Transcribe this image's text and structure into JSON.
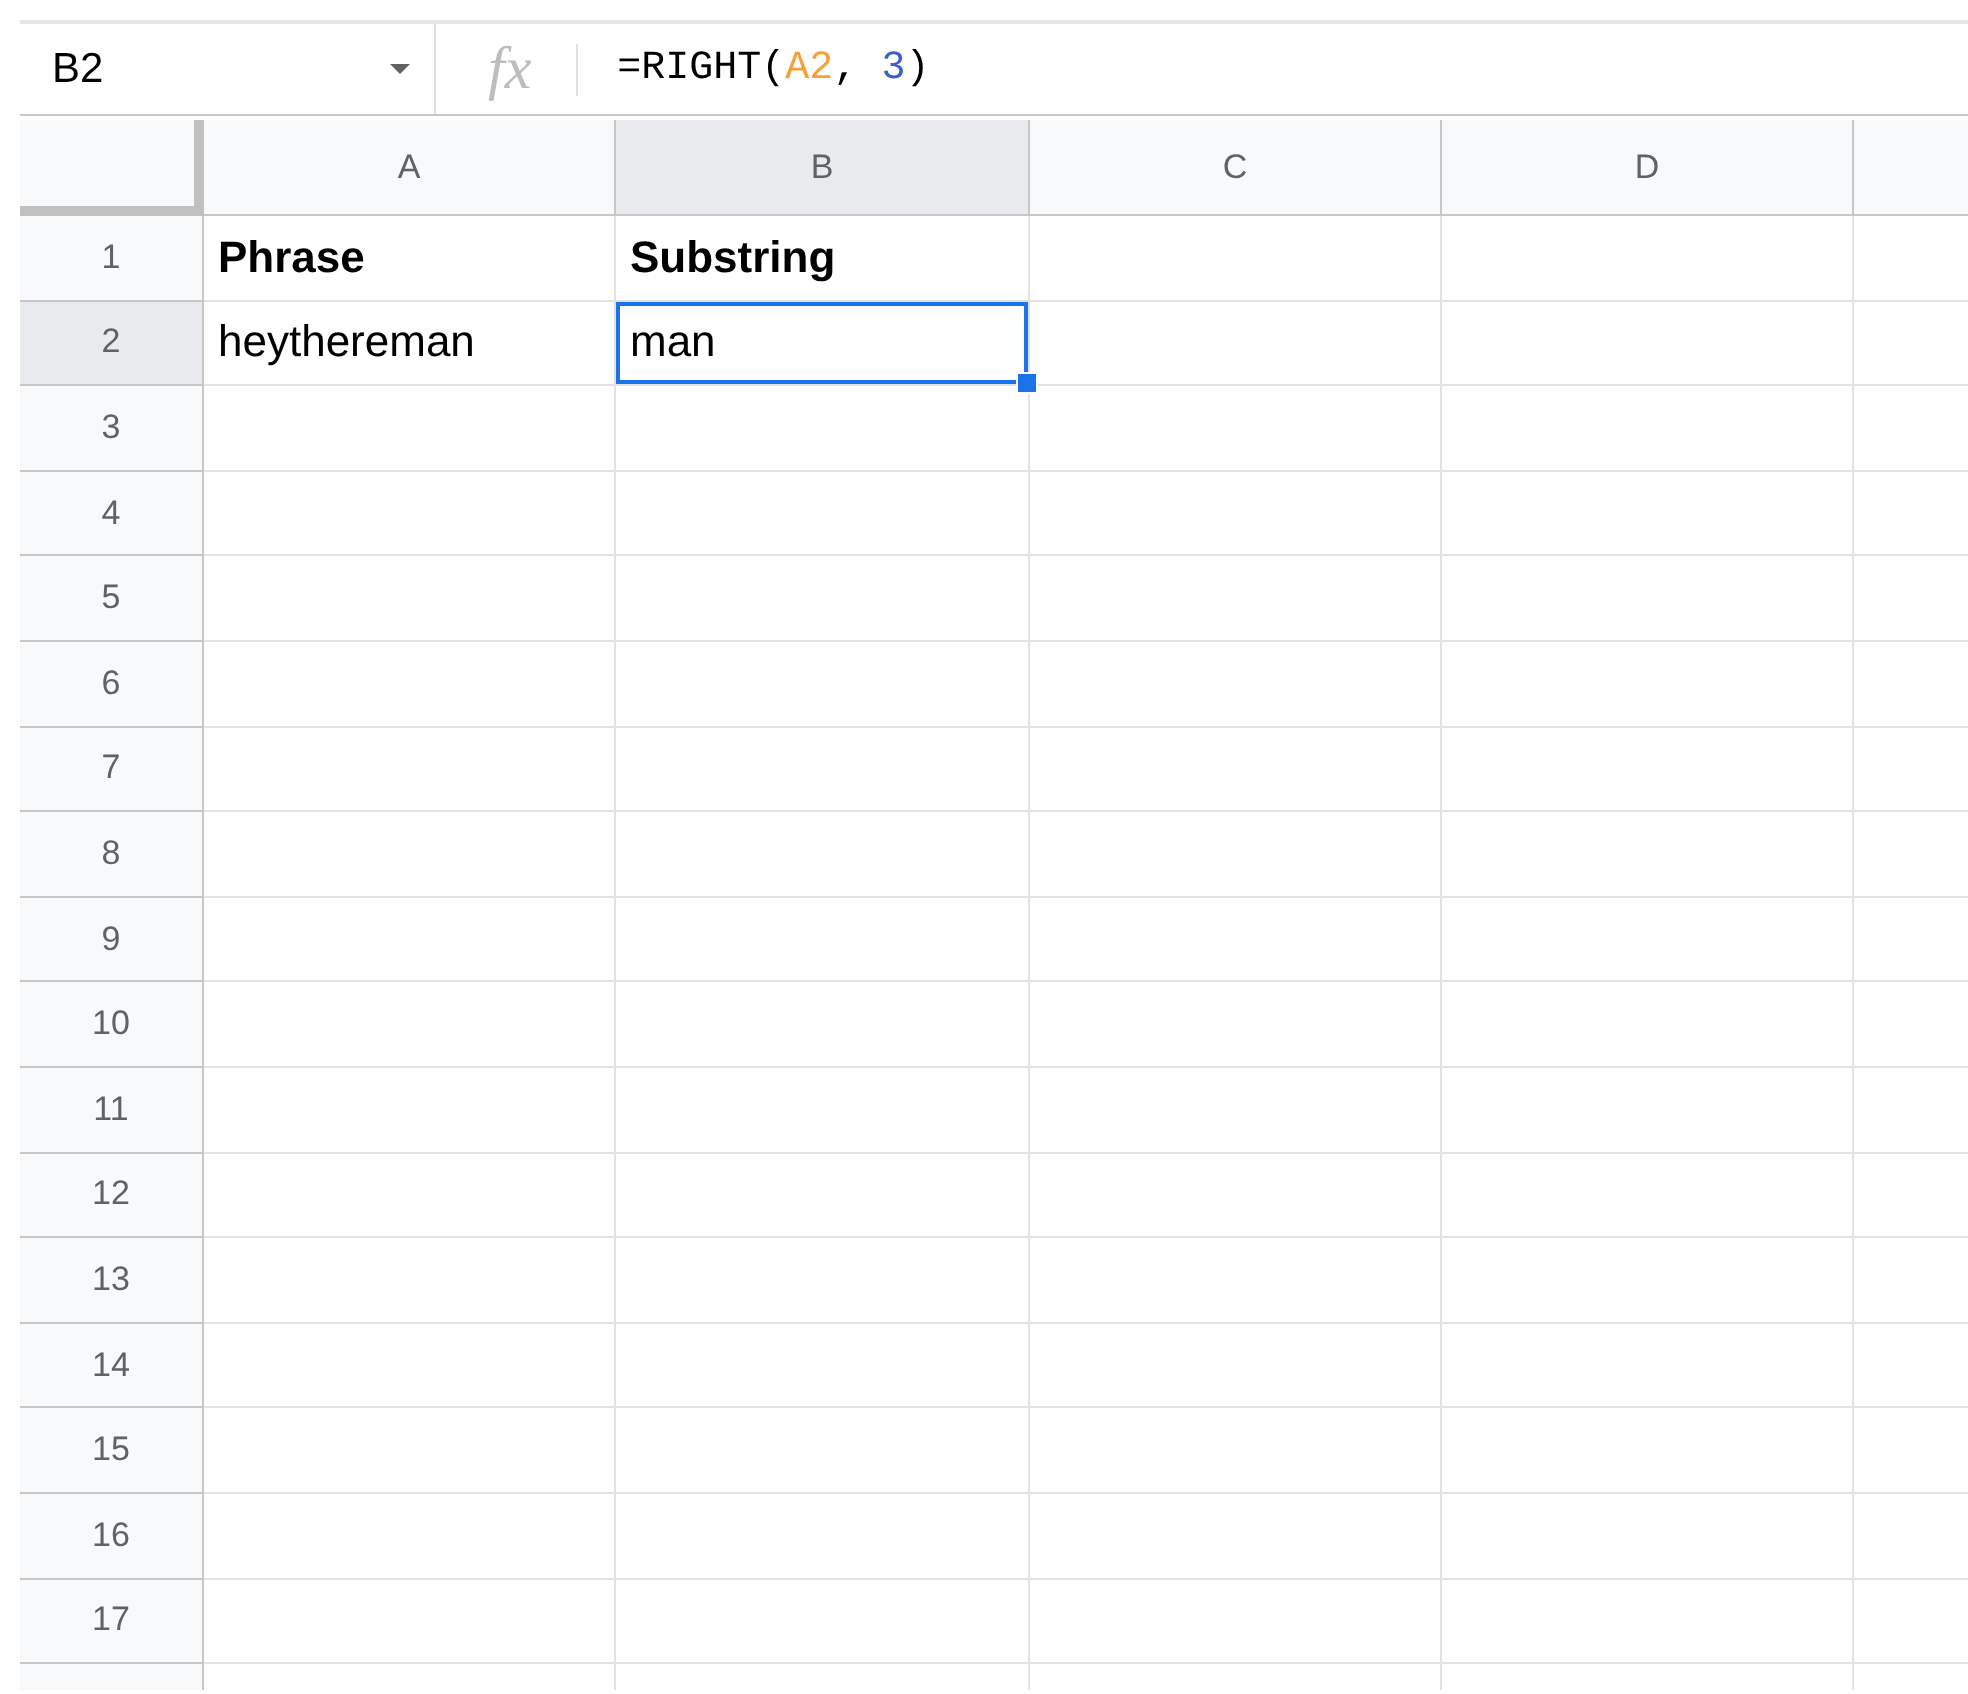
{
  "formula_bar": {
    "name_box": "B2",
    "fx_label": "fx",
    "formula": [
      {
        "text": "=RIGHT(",
        "kind": "plain"
      },
      {
        "text": "A2",
        "kind": "reference"
      },
      {
        "text": ", ",
        "kind": "plain"
      },
      {
        "text": "3",
        "kind": "number"
      },
      {
        "text": ")",
        "kind": "plain"
      }
    ]
  },
  "columns": [
    {
      "label": "A",
      "selected": false
    },
    {
      "label": "B",
      "selected": true
    },
    {
      "label": "C",
      "selected": false
    },
    {
      "label": "D",
      "selected": false
    }
  ],
  "rows": [
    {
      "number": "1",
      "selected": false,
      "cells": [
        {
          "text": "Phrase",
          "bold": true,
          "selected": false
        },
        {
          "text": "Substring",
          "bold": true,
          "selected": false
        }
      ]
    },
    {
      "number": "2",
      "selected": true,
      "cells": [
        {
          "text": "heythereman",
          "bold": false,
          "selected": false
        },
        {
          "text": "man",
          "bold": false,
          "selected": true
        }
      ]
    },
    {
      "number": "3",
      "selected": false
    },
    {
      "number": "4",
      "selected": false
    },
    {
      "number": "5",
      "selected": false
    },
    {
      "number": "6",
      "selected": false
    },
    {
      "number": "7",
      "selected": false
    },
    {
      "number": "8",
      "selected": false
    },
    {
      "number": "9",
      "selected": false
    },
    {
      "number": "10",
      "selected": false
    },
    {
      "number": "11",
      "selected": false
    },
    {
      "number": "12",
      "selected": false
    },
    {
      "number": "13",
      "selected": false
    },
    {
      "number": "14",
      "selected": false
    },
    {
      "number": "15",
      "selected": false
    },
    {
      "number": "16",
      "selected": false
    },
    {
      "number": "17",
      "selected": false
    }
  ]
}
